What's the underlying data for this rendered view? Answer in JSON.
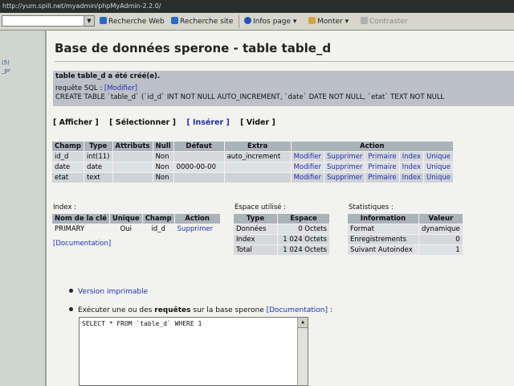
{
  "browser": {
    "url": "http://yum.spill.net/myadmin/phpMyAdmin-2.2.0/",
    "toolbar": {
      "search_web": "Recherche Web",
      "search_site": "Recherche site",
      "infos": "Infos page",
      "monter": "Monter",
      "contraster": "Contraster",
      "colors": {
        "search": "#2a6acc",
        "infos": "#1e52b8",
        "monter": "#d9a23b"
      }
    }
  },
  "left_pane": {
    "items": [
      "(5)",
      "_pr"
    ]
  },
  "page": {
    "title": "Base de données sperone - table table_d",
    "message": {
      "head": "table table_d a été créé(e).",
      "query_label": "requête SQL :",
      "modify_link": "[Modifier]",
      "sql": "CREATE TABLE `table_d` (`id_d` INT NOT NULL AUTO_INCREMENT, `date` DATE NOT NULL, `etat` TEXT NOT NULL"
    },
    "nav": [
      "[ Afficher ]",
      "[ Sélectionner ]",
      "[ Insérer ]",
      "[ Vider ]"
    ],
    "structure": {
      "headers": [
        "Champ",
        "Type",
        "Attributs",
        "Null",
        "Défaut",
        "Extra",
        "Action"
      ],
      "actions": [
        "Modifier",
        "Supprimer",
        "Primaire",
        "Index",
        "Unique"
      ],
      "rows": [
        {
          "champ": "id_d",
          "type": "int(11)",
          "attributs": "",
          "null": "Non",
          "defaut": "",
          "extra": "auto_increment"
        },
        {
          "champ": "date",
          "type": "date",
          "attributs": "",
          "null": "Non",
          "defaut": "0000-00-00",
          "extra": ""
        },
        {
          "champ": "etat",
          "type": "text",
          "attributs": "",
          "null": "Non",
          "defaut": "",
          "extra": ""
        }
      ]
    },
    "index": {
      "label": "Index :",
      "headers": [
        "Nom de la clé",
        "Unique",
        "Champ",
        "Action"
      ],
      "row": {
        "nom": "PRIMARY",
        "unique": "Oui",
        "champ": "id_d",
        "action": "Supprimer"
      },
      "doc": "[Documentation]"
    },
    "space": {
      "label": "Espace utilisé :",
      "headers": [
        "Type",
        "Espace"
      ],
      "rows": [
        {
          "type": "Données",
          "espace": "0 Octets"
        },
        {
          "type": "Index",
          "espace": "1 024 Octets"
        },
        {
          "type": "Total",
          "espace": "1 024 Octets"
        }
      ]
    },
    "stats": {
      "label": "Statistiques :",
      "headers": [
        "Information",
        "Valeur"
      ],
      "rows": [
        {
          "info": "Format",
          "valeur": "dynamique"
        },
        {
          "info": "Enregistrements",
          "valeur": "0"
        },
        {
          "info": "Suivant Autoindex",
          "valeur": "1"
        }
      ]
    },
    "version_link": "Version imprimable",
    "exec": {
      "prefix": "Exécuter une ou des",
      "bold": "requêtes",
      "mid": "sur la base sperone",
      "doc": "[Documentation]",
      "suffix": ":",
      "query": "SELECT * FROM `table_d` WHERE 1"
    }
  }
}
